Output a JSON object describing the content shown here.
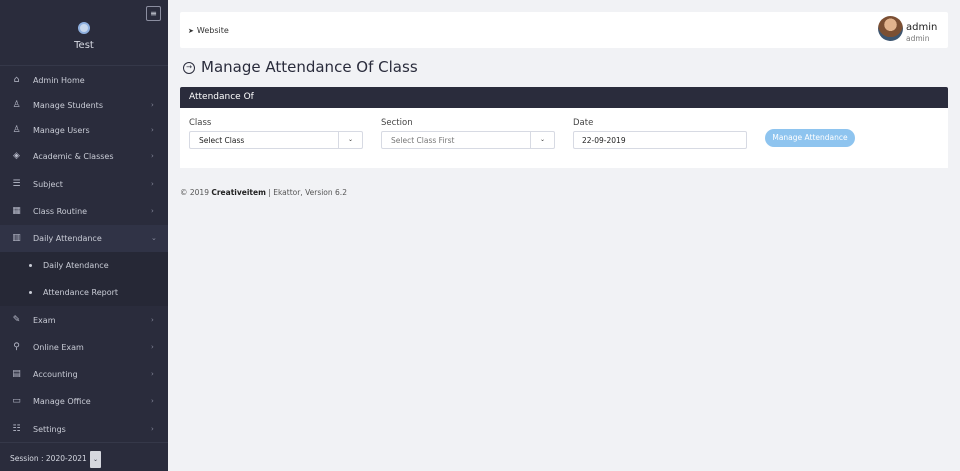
{
  "sidebar": {
    "school_name": "Test",
    "toggle_icon": "menu-icon",
    "items": [
      {
        "label": "Admin Home",
        "icon": "home-icon"
      },
      {
        "label": "Manage Students",
        "icon": "user-icon"
      },
      {
        "label": "Manage Users",
        "icon": "users-icon"
      },
      {
        "label": "Academic & Classes",
        "icon": "layers-icon"
      },
      {
        "label": "Subject",
        "icon": "list-icon"
      },
      {
        "label": "Class Routine",
        "icon": "calendar-icon"
      },
      {
        "label": "Daily Attendance",
        "icon": "building-icon"
      },
      {
        "label": "Exam",
        "icon": "pencil-icon"
      },
      {
        "label": "Online Exam",
        "icon": "location-icon"
      },
      {
        "label": "Accounting",
        "icon": "receipt-icon"
      },
      {
        "label": "Manage Office",
        "icon": "monitor-icon"
      },
      {
        "label": "Settings",
        "icon": "settings-icon"
      }
    ],
    "submenu": [
      {
        "label": "Daily Atendance"
      },
      {
        "label": "Attendance Report"
      }
    ],
    "session_label": "Session : 2020-2021"
  },
  "topbar": {
    "website_label": "Website",
    "user_name": "admin",
    "user_role": "admin"
  },
  "page": {
    "title": "Manage Attendance Of Class"
  },
  "card": {
    "header": "Attendance Of",
    "class_label": "Class",
    "class_value": "Select Class",
    "section_label": "Section",
    "section_value": "Select Class First",
    "date_label": "Date",
    "date_value": "22-09-2019",
    "button_label": "Manage Attendance"
  },
  "footer": {
    "prefix": "© 2019 ",
    "company": "Creativeitem",
    "suffix": " | Ekattor, Version 6.2"
  }
}
